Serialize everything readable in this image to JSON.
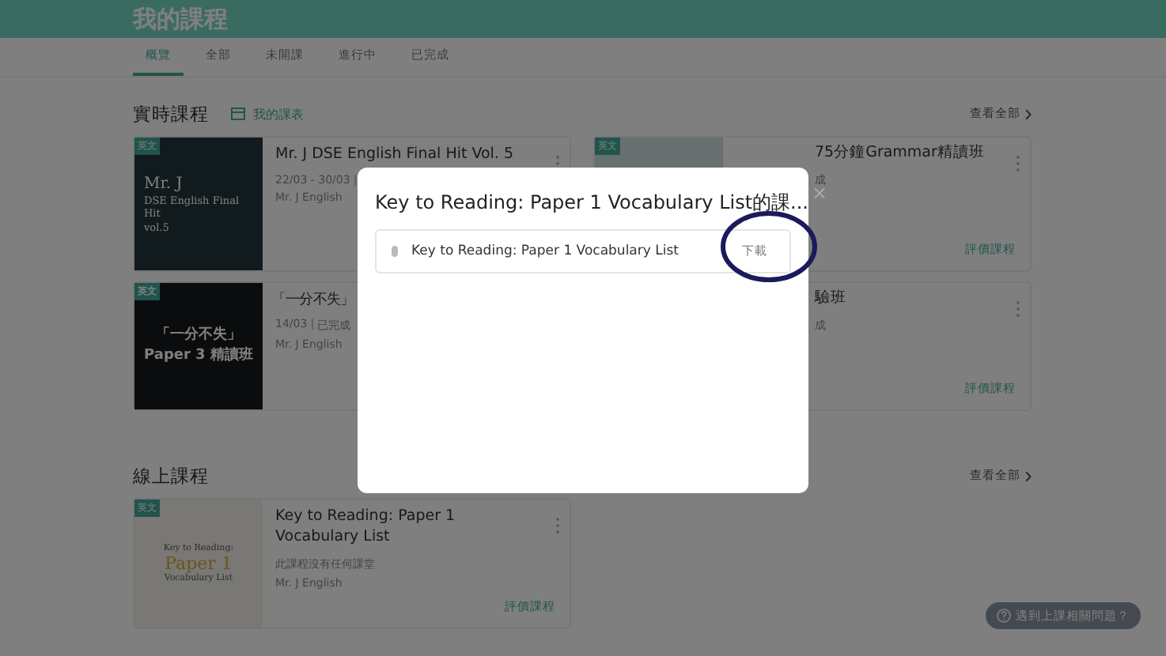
{
  "page_title": "我的課程",
  "tabs": [
    {
      "label": "概覽",
      "selected": true
    },
    {
      "label": "全部",
      "selected": false
    },
    {
      "label": "未開課",
      "selected": false
    },
    {
      "label": "進行中",
      "selected": false
    },
    {
      "label": "已完成",
      "selected": false
    }
  ],
  "live_section": {
    "title": "實時課程",
    "schedule_link": "我的課表",
    "view_all": "查看全部"
  },
  "live_courses": [
    {
      "kind": "full",
      "tag": "英文",
      "cover": {
        "kind": "dark",
        "lines": [
          "Mr. J",
          "DSE English Final Hit",
          "vol.5"
        ]
      },
      "title": "Mr. J DSE English Final Hit Vol. 5",
      "date": "22/03 - 30/03",
      "separator": "|",
      "teacher": "Mr. J English"
    },
    {
      "kind": "right",
      "tag": "英文",
      "cover": {
        "kind": "plain"
      },
      "title": "75分鐘Grammar精讀班",
      "status": "成",
      "rate_link": "評價課程"
    },
    {
      "kind": "left",
      "tag": "英文",
      "cover": {
        "kind": "black",
        "lines": [
          "「一分不失」",
          "Paper 3 精讀班"
        ]
      },
      "title": "「一分不失」",
      "date": "14/03",
      "separator": "|",
      "status": "已完成",
      "teacher": "Mr. J English"
    },
    {
      "kind": "right",
      "title": "驗班",
      "status": "成",
      "rate_link": "評價課程"
    }
  ],
  "online_section": {
    "title": "線上課程",
    "view_all": "查看全部"
  },
  "online_courses": [
    {
      "kind": "full",
      "tag": "英文",
      "cover": {
        "kind": "light",
        "lines": [
          "Key to Reading:",
          "Paper 1",
          "Vocabulary List"
        ]
      },
      "title": "Key to Reading: Paper 1 Vocabulary List",
      "status": "此課程沒有任何課堂",
      "teacher": "Mr. J English",
      "rate_link": "評價課程"
    }
  ],
  "help_button": "遇到上課相關問題？",
  "dialog": {
    "title": "Key to Reading: Paper 1 Vocabulary List的課...",
    "close": "×",
    "files": [
      {
        "name": "Key to Reading: Paper 1 Vocabulary List",
        "download": "下載"
      }
    ]
  }
}
